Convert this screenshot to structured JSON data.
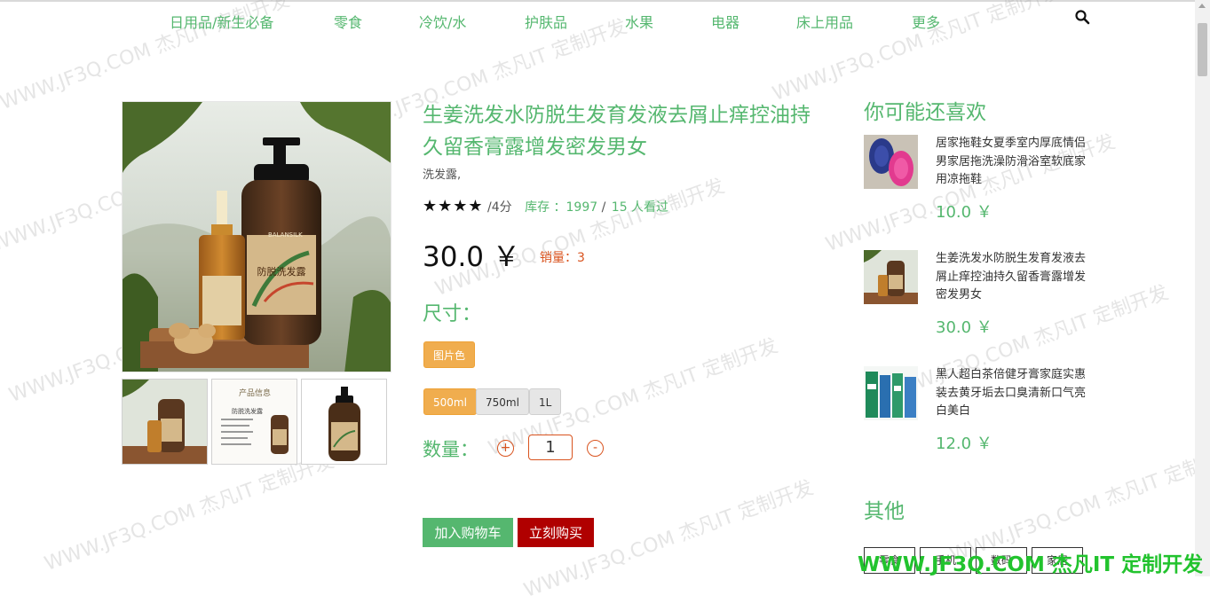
{
  "nav": {
    "items": [
      "日用品/新生必备",
      "零食",
      "冷饮/水",
      "护肤品",
      "水果",
      "电器",
      "床上用品",
      "更多"
    ]
  },
  "product": {
    "title": "生姜洗发水防脱生发育发液去屑止痒控油持久留香膏露增发密发男女",
    "subtitle": "洗发露,",
    "stars": "★★★★",
    "score": "/4分",
    "stock": "库存 ：1997",
    "separator": "/",
    "views": "15 人看过",
    "price": "30.0 ￥",
    "sales": "销量：3",
    "size_label": "尺寸：",
    "color_option": "图片色",
    "size_options": [
      "500ml",
      "750ml",
      "1L"
    ],
    "qty_label": "数量：",
    "qty_plus": "+",
    "qty_minus": "-",
    "qty_value": "1",
    "add_cart": "加入购物车",
    "buy_now": "立刻购买",
    "bottle_label": "防脱洗发露",
    "bottle_brand": "BALANSILK",
    "thumb_info_title": "产品信息",
    "thumb_info_sub": "防脱洗发露"
  },
  "sidebar": {
    "title": "你可能还喜欢",
    "items": [
      {
        "name": "居家拖鞋女夏季室内厚底情侣男家居拖洗澡防滑浴室软底家用凉拖鞋",
        "price": "10.0 ￥"
      },
      {
        "name": "生姜洗发水防脱生发育发液去屑止痒控油持久留香膏露增发密发男女",
        "price": "30.0 ￥"
      },
      {
        "name": "黑人超白茶倍健牙膏家庭实惠装去黄牙垢去口臭清新口气亮白美白",
        "price": "12.0 ￥"
      }
    ],
    "other_title": "其他",
    "other_items": [
      "零食",
      "手机",
      "数码",
      "家居"
    ]
  },
  "watermark": {
    "text": "WWW.JF3Q.COM 杰凡IT 定制开发",
    "bottom": "WWW.JF3Q.COM 杰凡IT  定制开发"
  },
  "colors": {
    "accent_green": "#55b76f",
    "orange": "#f0ad4e",
    "buy_red": "#b00000",
    "sales_orange": "#d9531e"
  }
}
